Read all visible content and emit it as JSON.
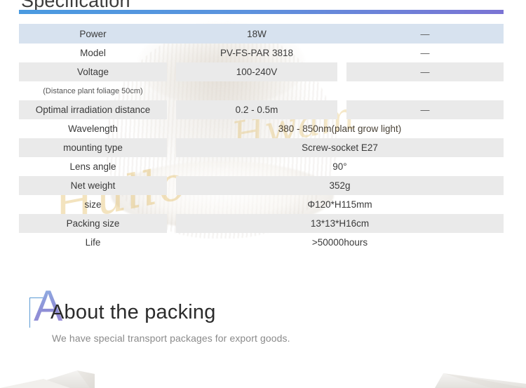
{
  "section": {
    "title": "Specification",
    "rule_gradient_from": "#4a9ae0",
    "rule_gradient_to": "#7b74d4"
  },
  "spec_table": {
    "header": {
      "label": "Power",
      "value": "18W",
      "extra": "—"
    },
    "rows": [
      {
        "label": "Model",
        "value": "PV-FS-PAR 3818",
        "extra": "—",
        "layout": "three",
        "shaded": false
      },
      {
        "label": "Voltage",
        "value": "100-240V",
        "extra": "—",
        "layout": "three",
        "shaded": true
      },
      {
        "label": "(Distance plant foliage 50cm)",
        "value": "",
        "extra": "",
        "layout": "note",
        "shaded": false
      },
      {
        "label": "Optimal irradiation distance",
        "value": "0.2 - 0.5m",
        "extra": "—",
        "layout": "three",
        "shaded": true
      },
      {
        "label": "Wavelength",
        "value": "380 - 850nm(plant grow light)",
        "extra": "",
        "layout": "merged",
        "shaded": false
      },
      {
        "label": "mounting type",
        "value": "Screw-socket E27",
        "extra": "",
        "layout": "merged",
        "shaded": true
      },
      {
        "label": "Lens angle",
        "value": "90°",
        "extra": "",
        "layout": "merged",
        "shaded": false
      },
      {
        "label": "Net weight",
        "value": "352g",
        "extra": "",
        "layout": "merged",
        "shaded": true
      },
      {
        "label": "size",
        "value": "Φ120*H115mm",
        "extra": "",
        "layout": "merged",
        "shaded": false
      },
      {
        "label": "Packing size",
        "value": "13*13*H16cm",
        "extra": "",
        "layout": "merged",
        "shaded": true
      },
      {
        "label": "Life",
        "value": ">50000hours",
        "extra": "",
        "layout": "merged",
        "shaded": false
      }
    ]
  },
  "about": {
    "drop_cap": "A",
    "title": "About the packing",
    "subtitle": "We have special transport packages for export goods.",
    "accent_color": "#5b9bd5"
  },
  "watermark": {
    "script_text": "Hullo",
    "script_text2": "Hwam"
  }
}
